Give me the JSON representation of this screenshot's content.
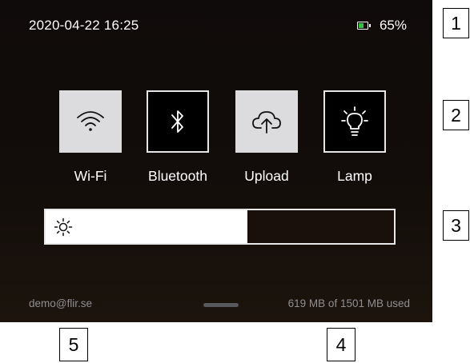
{
  "status_bar": {
    "datetime": "2020-04-22  16:25",
    "battery_percent": "65%",
    "battery_level": 0.65,
    "battery_color": "#36c23a"
  },
  "toggles": [
    {
      "label": "Wi-Fi",
      "icon": "wifi-icon",
      "state": "on"
    },
    {
      "label": "Bluetooth",
      "icon": "bluetooth-icon",
      "state": "off"
    },
    {
      "label": "Upload",
      "icon": "cloud-upload-icon",
      "state": "on"
    },
    {
      "label": "Lamp",
      "icon": "lightbulb-icon",
      "state": "off"
    }
  ],
  "brightness": {
    "icon": "sun-icon",
    "level_fraction": 0.58
  },
  "footer": {
    "account": "demo@flir.se",
    "storage": "619 MB of 1501 MB used"
  },
  "callouts": [
    "1",
    "2",
    "3",
    "4",
    "5"
  ],
  "colors": {
    "background": "#0f0b0a",
    "toggle_on": "#dcdcde",
    "toggle_off": "#000000",
    "footer_text": "#8f8f92"
  }
}
